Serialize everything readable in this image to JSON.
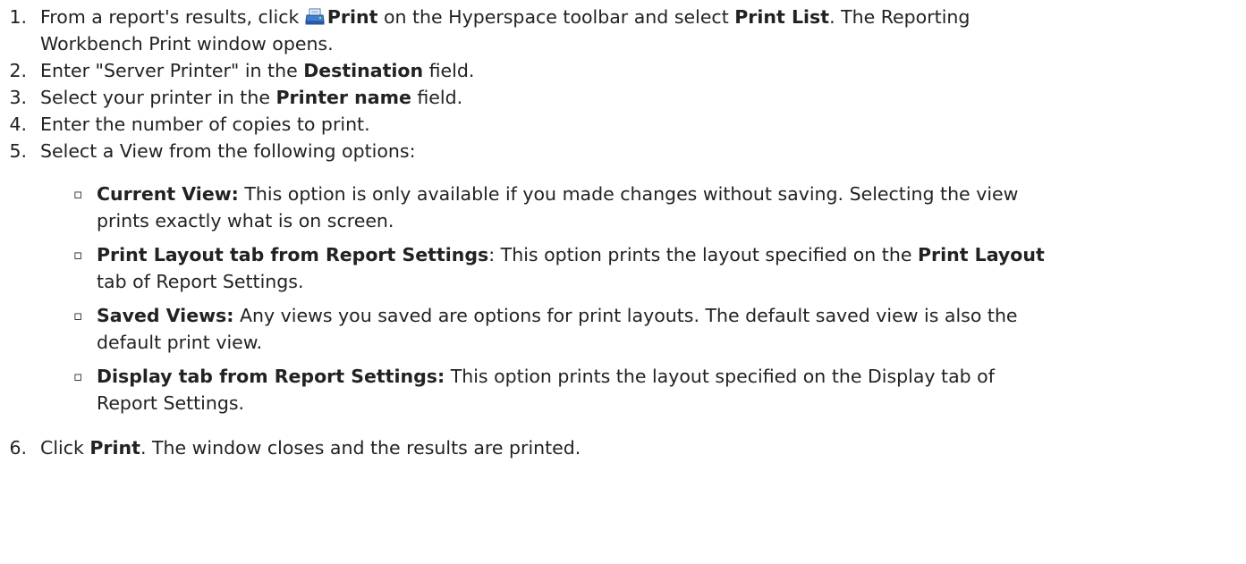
{
  "steps": [
    {
      "num": "1.",
      "lines": [
        [
          "From a report's results, click ",
          {
            "icon": "printer-icon"
          },
          {
            "b": "Print"
          },
          " on the Hyperspace toolbar and select ",
          {
            "b": "Print List"
          },
          ". The Reporting"
        ],
        [
          "Workbench Print window opens."
        ]
      ]
    },
    {
      "num": "2.",
      "lines": [
        [
          "Enter \"Server Printer\" in the ",
          {
            "b": "Destination"
          },
          " field."
        ]
      ]
    },
    {
      "num": "3.",
      "lines": [
        [
          "Select your printer in the ",
          {
            "b": "Printer name"
          },
          " field."
        ]
      ]
    },
    {
      "num": "4.",
      "lines": [
        [
          "Enter the number of copies to print."
        ]
      ]
    },
    {
      "num": "5.",
      "lines": [
        [
          "Select a View from the following options:"
        ]
      ]
    },
    {
      "num": "6.",
      "lines": [
        [
          "Click ",
          {
            "b": "Print"
          },
          ". The window closes and the results are printed."
        ]
      ]
    }
  ],
  "bullets": [
    {
      "marker": "▫",
      "lines": [
        [
          {
            "b": "Current View:"
          },
          " This option is only available if you made changes without saving. Selecting the view"
        ],
        [
          "prints exactly what is on screen."
        ]
      ]
    },
    {
      "marker": "▫",
      "lines": [
        [
          {
            "b": "Print Layout tab from Report Settings"
          },
          ": This option prints the layout specified on the ",
          {
            "b": "Print Layout"
          }
        ],
        [
          "tab of Report Settings."
        ]
      ]
    },
    {
      "marker": "▫",
      "lines": [
        [
          {
            "b": "Saved Views:"
          },
          " Any views you saved are options for print layouts. The default saved view is also the"
        ],
        [
          "default print view."
        ]
      ]
    },
    {
      "marker": "▫",
      "lines": [
        [
          {
            "b": "Display tab from Report Settings:"
          },
          " This option prints the layout specified on the Display tab of"
        ],
        [
          "Report Settings."
        ]
      ]
    }
  ]
}
